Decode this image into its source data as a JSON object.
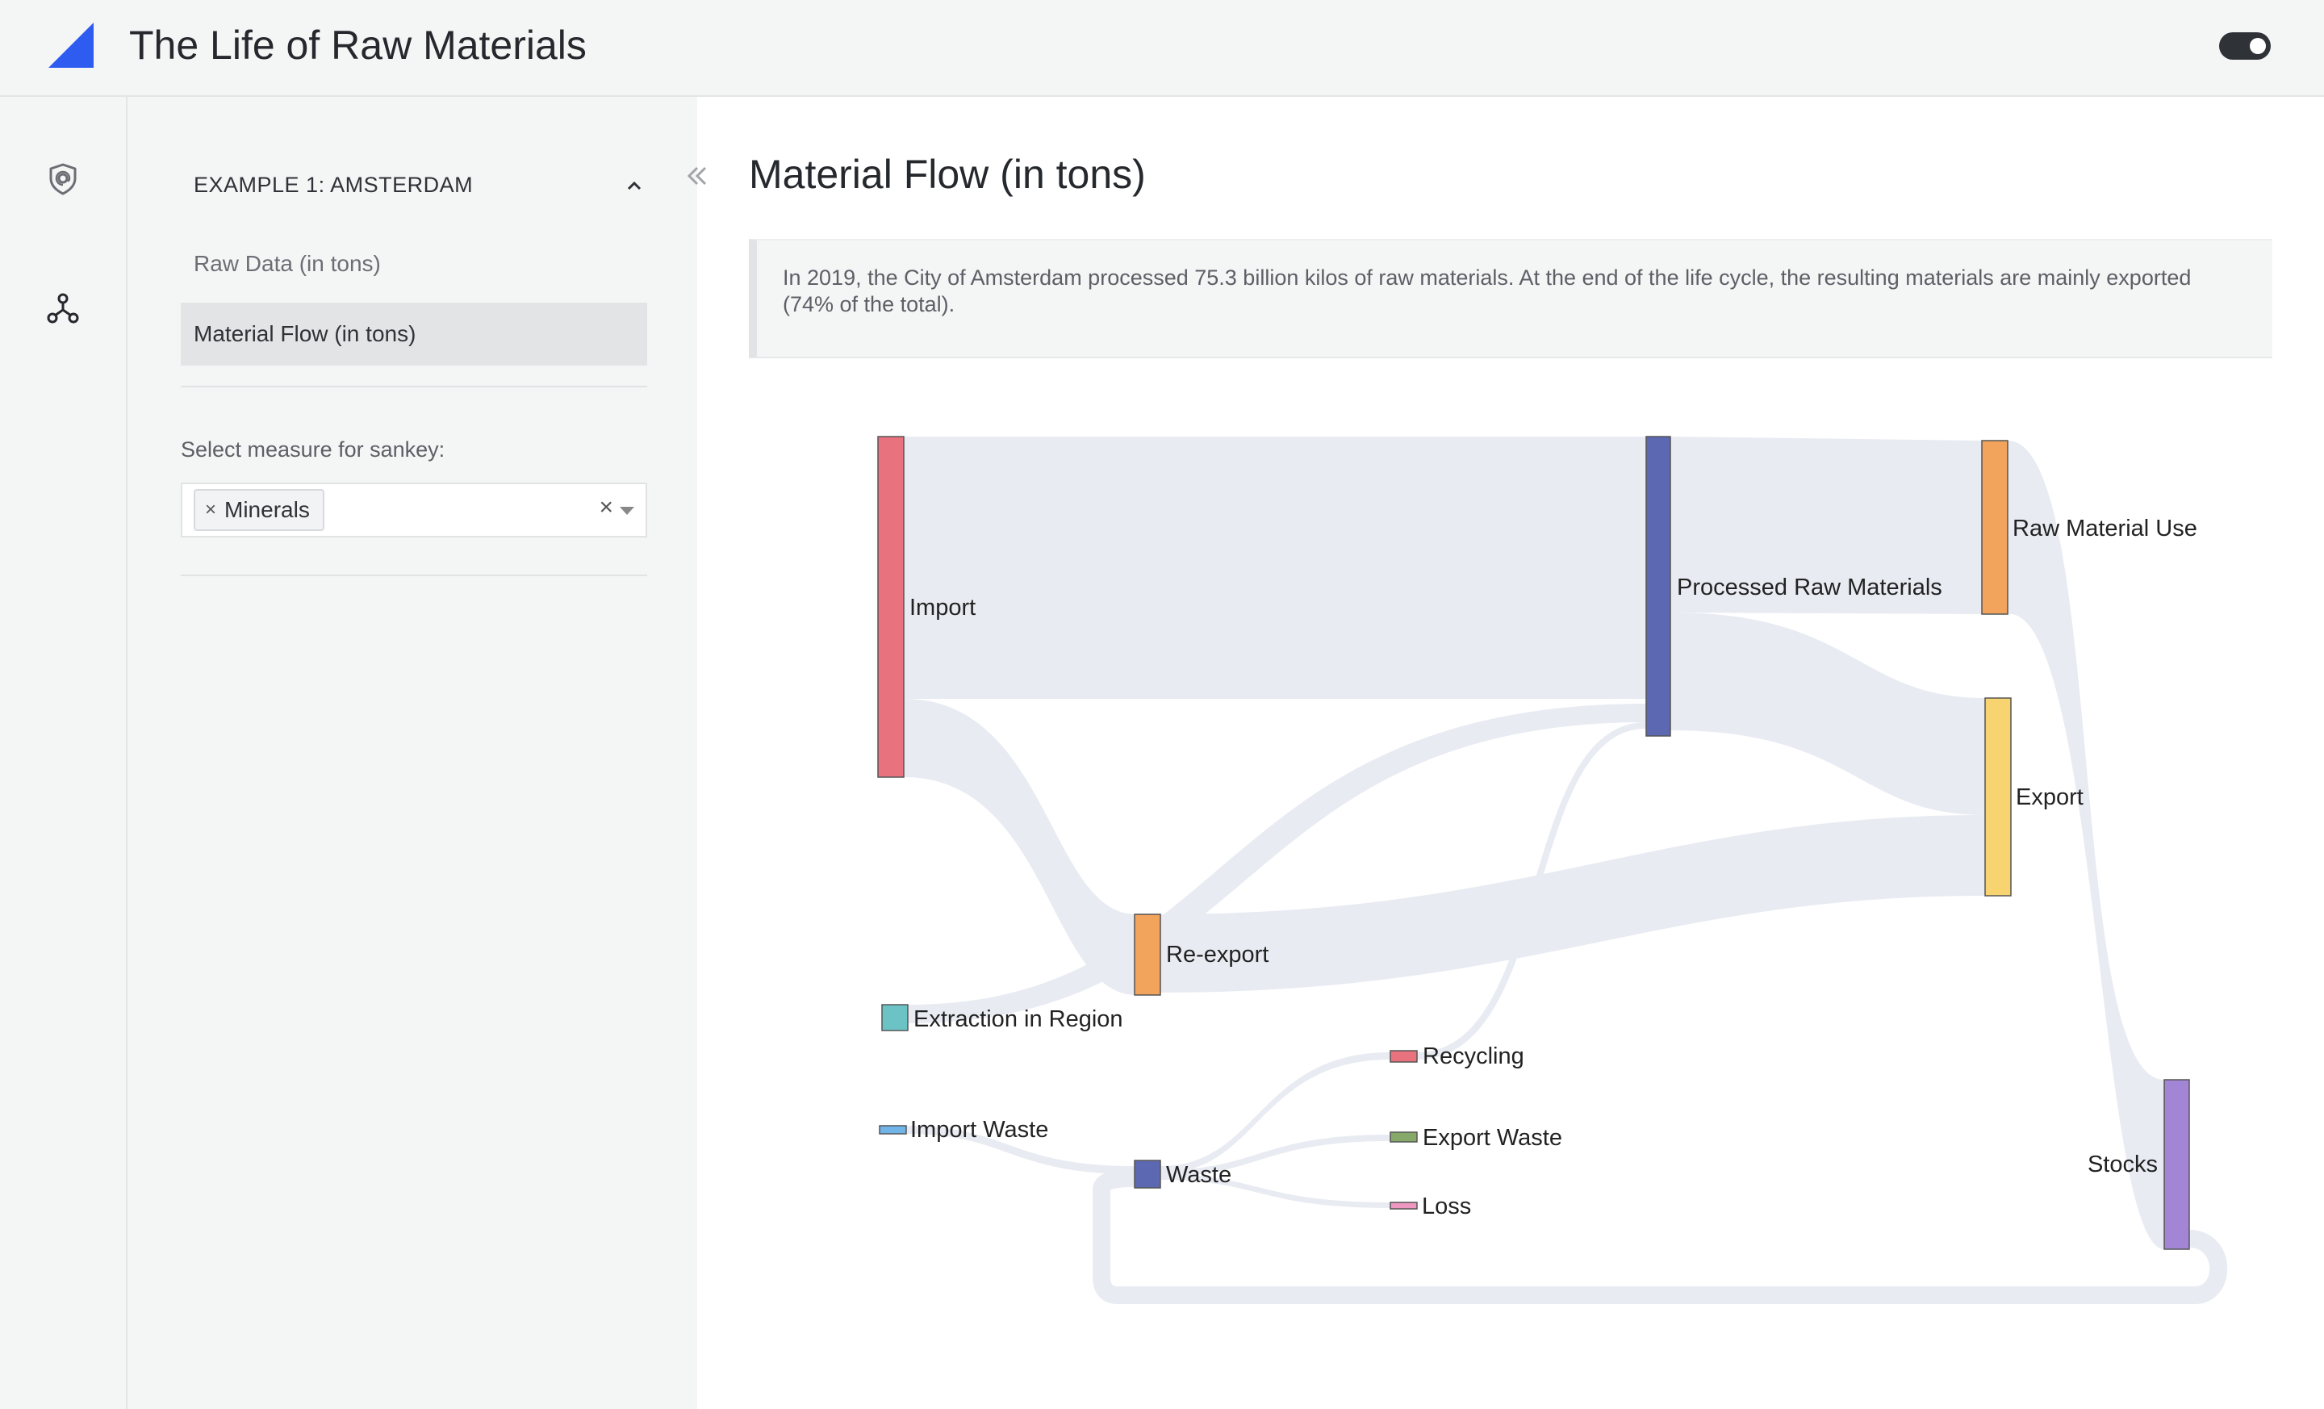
{
  "header": {
    "title": "The Life of Raw Materials"
  },
  "sidebar": {
    "section_title": "EXAMPLE 1: AMSTERDAM",
    "items": [
      {
        "label": "Raw Data (in tons)"
      },
      {
        "label": "Material Flow (in tons)"
      }
    ],
    "measure_label": "Select measure for sankey:",
    "measure_selected": "Minerals"
  },
  "main": {
    "title": "Material Flow (in tons)",
    "description": "In 2019, the City of Amsterdam processed 75.3 billion kilos of raw materials. At the end of the life cycle, the resulting materials are mainly exported (74% of the total)."
  },
  "colors": {
    "link": "#e8ebf2",
    "import": "#e9727f",
    "processed": "#5d68b3",
    "raw_use": "#f2a35c",
    "export": "#f7d46f",
    "reexport": "#f2a35c",
    "extraction": "#6cc3c6",
    "import_waste": "#70b4e8",
    "waste": "#5d68b3",
    "recycling": "#e9727f",
    "export_waste": "#86a96a",
    "loss": "#ee97c0",
    "stocks": "#a385d6"
  },
  "chart_data": {
    "type": "sankey",
    "nodes": [
      "Import",
      "Processed Raw Materials",
      "Raw Material Use",
      "Export",
      "Re-export",
      "Extraction in Region",
      "Import Waste",
      "Waste",
      "Recycling",
      "Export Waste",
      "Loss",
      "Stocks"
    ]
  }
}
